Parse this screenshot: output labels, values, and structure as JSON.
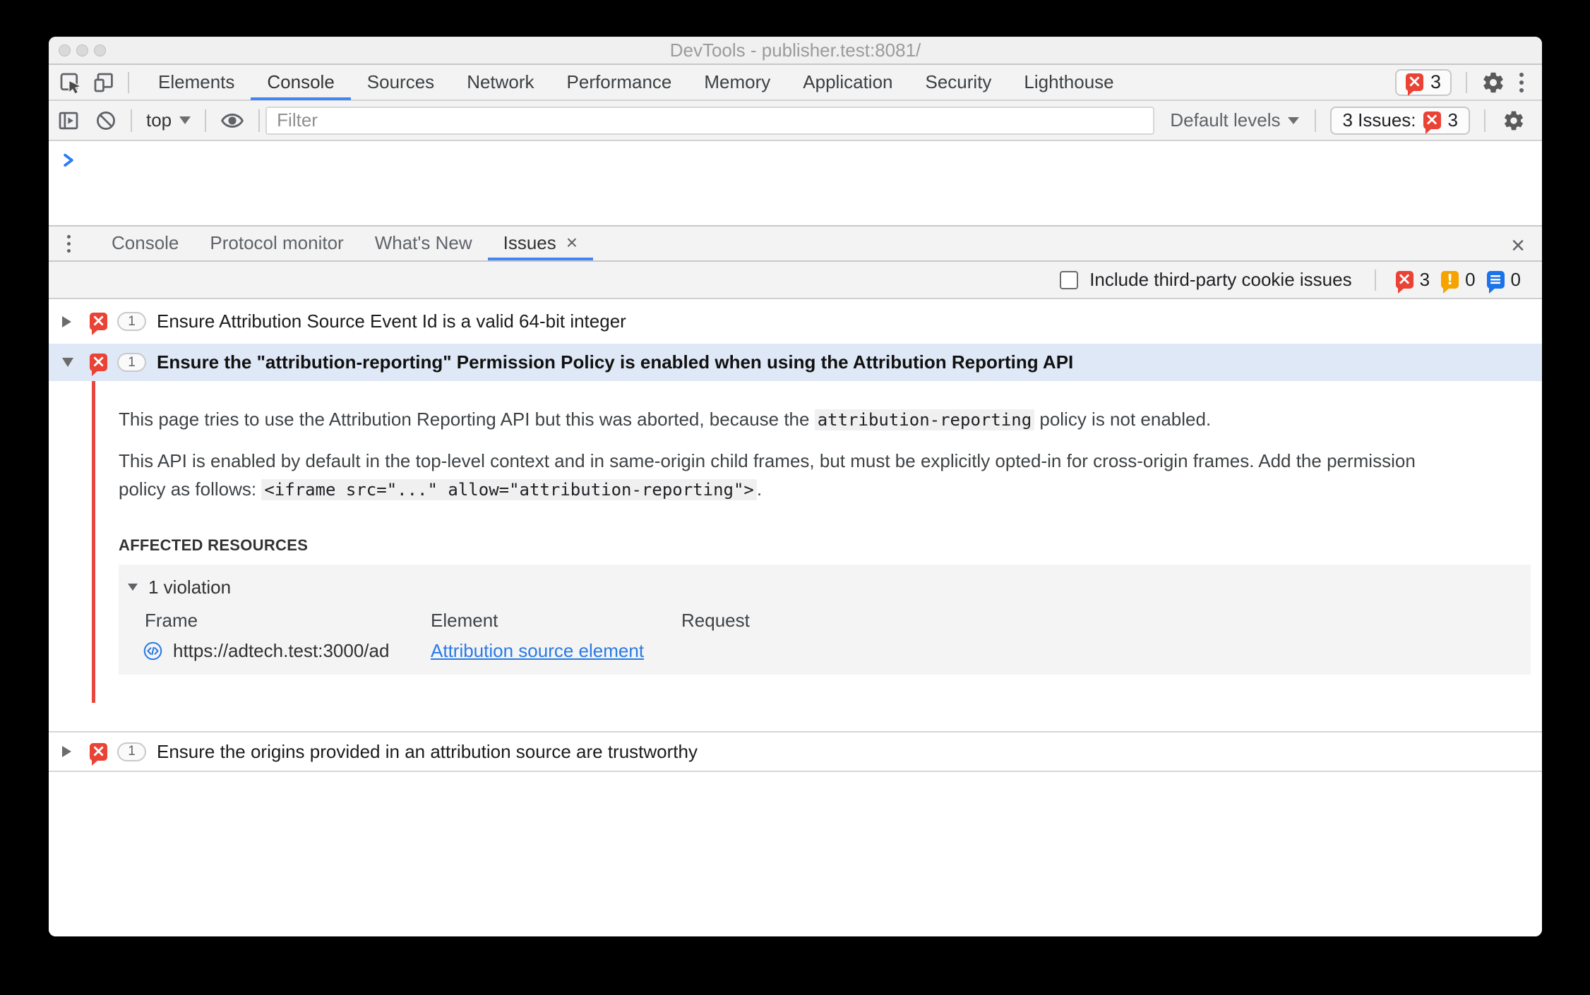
{
  "window": {
    "title": "DevTools - publisher.test:8081/"
  },
  "main_tabs": {
    "items": [
      "Elements",
      "Console",
      "Sources",
      "Network",
      "Performance",
      "Memory",
      "Application",
      "Security",
      "Lighthouse"
    ],
    "active": "Console",
    "error_badge_count": "3"
  },
  "console_toolbar": {
    "context_selector": "top",
    "filter_placeholder": "Filter",
    "levels_dropdown": "Default levels",
    "issues_button_label": "3 Issues:",
    "issues_button_count": "3"
  },
  "drawer": {
    "tabs": [
      "Console",
      "Protocol monitor",
      "What's New",
      "Issues"
    ],
    "active_tab": "Issues"
  },
  "issues_panel": {
    "checkbox_label": "Include third-party cookie issues",
    "error_count": "3",
    "warning_count": "0",
    "info_count": "0"
  },
  "issues": [
    {
      "count": "1",
      "title": "Ensure Attribution Source Event Id is a valid 64-bit integer"
    },
    {
      "count": "1",
      "title": "Ensure the \"attribution-reporting\" Permission Policy is enabled when using the Attribution Reporting API",
      "detail": {
        "p1_before": "This page tries to use the Attribution Reporting API but this was aborted, because the ",
        "p1_code": "attribution-reporting",
        "p1_after": " policy is not enabled.",
        "p2_before": "This API is enabled by default in the top-level context and in same-origin child frames, but must be explicitly opted-in for cross-origin frames. Add the permission policy as follows: ",
        "p2_code": "<iframe src=\"...\" allow=\"attribution-reporting\">",
        "p2_after": ".",
        "affected_heading": "AFFECTED RESOURCES",
        "violation_label": "1 violation",
        "table_headers": {
          "frame": "Frame",
          "element": "Element",
          "request": "Request"
        },
        "row": {
          "frame_url": "https://adtech.test:3000/ad",
          "element_link": "Attribution source element",
          "request": ""
        }
      }
    },
    {
      "count": "1",
      "title": "Ensure the origins provided in an attribution source are trustworthy"
    }
  ],
  "colors": {
    "accent_blue": "#4285f4",
    "error_red": "#ea4336",
    "warning_orange": "#f5a300",
    "info_blue": "#1a73e8",
    "selected_row": "#dfe8f6",
    "link_blue": "#2a7ae4",
    "issue_line_red": "#e8473f"
  },
  "icons": {
    "inspect": "cursor-in-square",
    "device_toolbar": "phone-and-screen",
    "panel_toggle": "sidebar-with-play",
    "clear_console": "no-entry-circle",
    "eye": "live-expression-eye",
    "gear": "settings-gear",
    "kebab": "three-vertical-dots",
    "error": "red-bubble-x",
    "warning": "orange-bubble-exclamation",
    "info": "blue-bubble-lines",
    "frame": "code-circle",
    "prompt": "blue-chevron"
  }
}
